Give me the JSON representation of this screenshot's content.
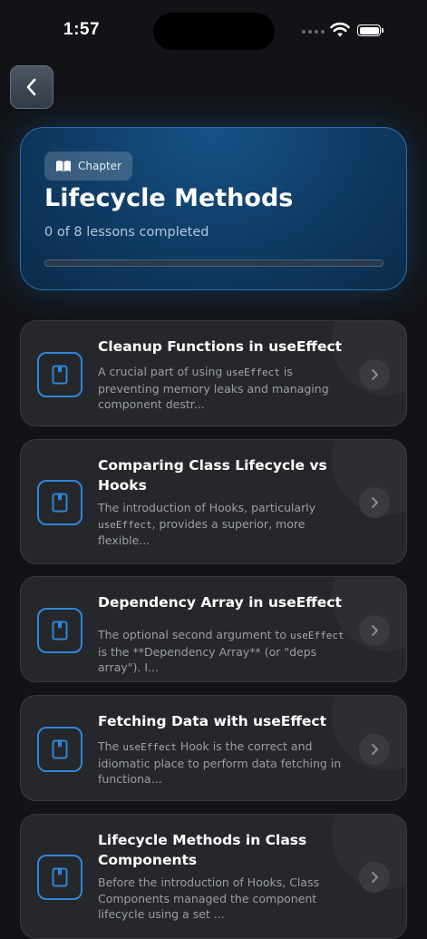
{
  "status_bar": {
    "time": "1:57"
  },
  "header": {
    "back_icon": "chevron-left-icon"
  },
  "chapter": {
    "badge_icon": "book-open-icon",
    "badge_label": "Chapter",
    "title": "Lifecycle Methods",
    "progress_text": "0 of 8 lessons completed",
    "completed": 0,
    "total": 8,
    "accent": "#2f86dc"
  },
  "lessons": [
    {
      "title": "Cleanup Functions in useEffect",
      "desc_before": "A crucial part of using ",
      "desc_code": "useEffect",
      "desc_after": " is preventing memory leaks and managing component destr..."
    },
    {
      "title": "Comparing Class Lifecycle vs Hooks",
      "desc_before": "The introduction of Hooks, particularly ",
      "desc_code": "useEffect",
      "desc_after": ", provides a superior, more flexible..."
    },
    {
      "title": "Dependency Array in useEffect",
      "desc_before": "The optional second argument to ",
      "desc_code": "useEffect",
      "desc_after": " is the **Dependency Array** (or \"deps array\"). I..."
    },
    {
      "title": "Fetching Data with useEffect",
      "desc_before": "The ",
      "desc_code": "useEffect",
      "desc_after": " Hook is the correct and idiomatic place to perform data fetching in functiona..."
    },
    {
      "title": "Lifecycle Methods in Class Components",
      "desc_before": "Before the introduction of Hooks, Class Components managed the component lifecycle using a set ...",
      "desc_code": "",
      "desc_after": ""
    }
  ]
}
